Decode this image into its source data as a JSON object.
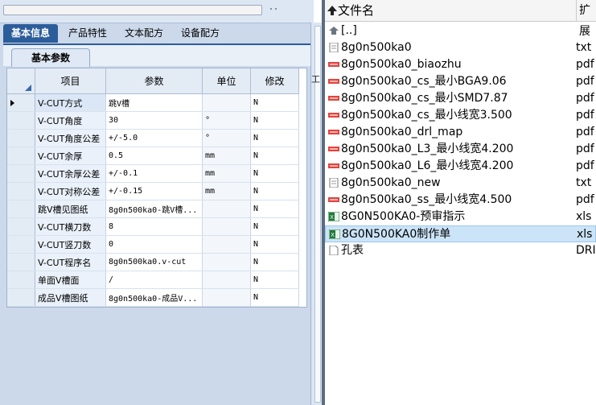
{
  "tabs": [
    {
      "label": "基本信息"
    },
    {
      "label": "产品特性"
    },
    {
      "label": "文本配方"
    },
    {
      "label": "设备配方"
    }
  ],
  "subtab": {
    "label": "基本参数"
  },
  "grid": {
    "headers": {
      "item": "项目",
      "param": "参数",
      "unit": "单位",
      "modify": "修改"
    },
    "rows": [
      {
        "item": "V-CUT方式",
        "param": "跳V槽",
        "unit": "",
        "modify": "N"
      },
      {
        "item": "V-CUT角度",
        "param": "30",
        "unit": "°",
        "modify": "N"
      },
      {
        "item": "V-CUT角度公差",
        "param": "+/-5.0",
        "unit": "°",
        "modify": "N"
      },
      {
        "item": "V-CUT余厚",
        "param": "0.5",
        "unit": "mm",
        "modify": "N"
      },
      {
        "item": "V-CUT余厚公差",
        "param": "+/-0.1",
        "unit": "mm",
        "modify": "N"
      },
      {
        "item": "V-CUT对称公差",
        "param": "+/-0.15",
        "unit": "mm",
        "modify": "N"
      },
      {
        "item": "跳V槽见图纸",
        "param": "8g0n500ka0-跳V槽...",
        "unit": "",
        "modify": "N"
      },
      {
        "item": "V-CUT横刀数",
        "param": "8",
        "unit": "",
        "modify": "N"
      },
      {
        "item": "V-CUT竖刀数",
        "param": "0",
        "unit": "",
        "modify": "N"
      },
      {
        "item": "V-CUT程序名",
        "param": "8g0n500ka0.v-cut",
        "unit": "",
        "modify": "N"
      },
      {
        "item": "单面V槽面",
        "param": "/",
        "unit": "",
        "modify": "N"
      },
      {
        "item": "成品V槽图纸",
        "param": "8g0n500ka0-成品V...",
        "unit": "",
        "modify": "N"
      }
    ]
  },
  "edge_label": "工",
  "filelist": {
    "header": {
      "name": "文件名",
      "ext": "扩展"
    },
    "items": [
      {
        "name": "[..]",
        "ext": "",
        "icon": "up-folder-icon"
      },
      {
        "name": "8g0n500ka0",
        "ext": "txt",
        "icon": "text-file-icon"
      },
      {
        "name": "8g0n500ka0_biaozhu",
        "ext": "pdf",
        "icon": "pdf-file-icon"
      },
      {
        "name": "8g0n500ka0_cs_最小BGA9.06",
        "ext": "pdf",
        "icon": "pdf-file-icon"
      },
      {
        "name": "8g0n500ka0_cs_最小SMD7.87",
        "ext": "pdf",
        "icon": "pdf-file-icon"
      },
      {
        "name": "8g0n500ka0_cs_最小线宽3.500",
        "ext": "pdf",
        "icon": "pdf-file-icon"
      },
      {
        "name": "8g0n500ka0_drl_map",
        "ext": "pdf",
        "icon": "pdf-file-icon"
      },
      {
        "name": "8g0n500ka0_L3_最小线宽4.200",
        "ext": "pdf",
        "icon": "pdf-file-icon"
      },
      {
        "name": "8g0n500ka0_L6_最小线宽4.200",
        "ext": "pdf",
        "icon": "pdf-file-icon"
      },
      {
        "name": "8g0n500ka0_new",
        "ext": "txt",
        "icon": "text-file-icon"
      },
      {
        "name": "8g0n500ka0_ss_最小线宽4.500",
        "ext": "pdf",
        "icon": "pdf-file-icon"
      },
      {
        "name": "8G0N500KA0-预审指示",
        "ext": "xls",
        "icon": "excel-file-icon"
      },
      {
        "name": "8G0N500KA0制作单",
        "ext": "xls",
        "icon": "excel-file-icon",
        "selected": true
      },
      {
        "name": "孔表",
        "ext": "DRI",
        "icon": "blank-file-icon"
      }
    ]
  },
  "colors": {
    "accent": "#2c5d9b",
    "pdf": "#e0443e",
    "excel": "#1f7a3a",
    "selection": "#cce4f7"
  }
}
